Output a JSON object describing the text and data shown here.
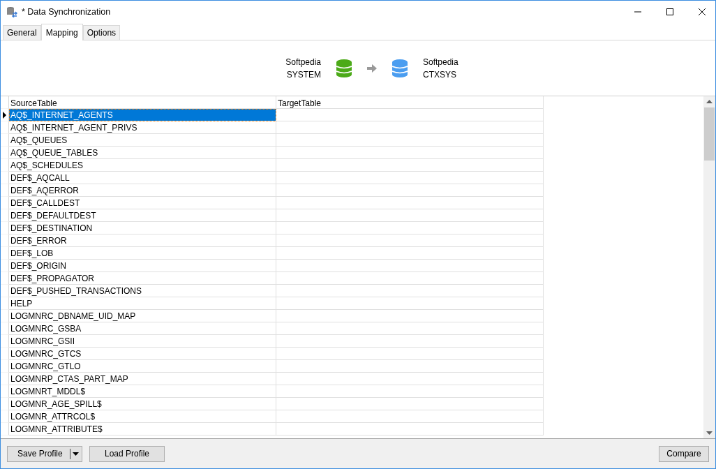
{
  "window": {
    "title": "* Data Synchronization"
  },
  "tabs": [
    {
      "label": "General",
      "selected": false
    },
    {
      "label": "Mapping",
      "selected": true
    },
    {
      "label": "Options",
      "selected": false
    }
  ],
  "source": {
    "name": "Softpedia",
    "schema": "SYSTEM"
  },
  "target": {
    "name": "Softpedia",
    "schema": "CTXSYS"
  },
  "table": {
    "columns": [
      "SourceTable",
      "TargetTable"
    ],
    "rows": [
      {
        "source": "AQ$_INTERNET_AGENTS",
        "selected": true
      },
      {
        "source": "AQ$_INTERNET_AGENT_PRIVS",
        "selected": false
      },
      {
        "source": "AQ$_QUEUES",
        "selected": false
      },
      {
        "source": "AQ$_QUEUE_TABLES",
        "selected": false
      },
      {
        "source": "AQ$_SCHEDULES",
        "selected": false
      },
      {
        "source": "DEF$_AQCALL",
        "selected": false
      },
      {
        "source": "DEF$_AQERROR",
        "selected": false
      },
      {
        "source": "DEF$_CALLDEST",
        "selected": false
      },
      {
        "source": "DEF$_DEFAULTDEST",
        "selected": false
      },
      {
        "source": "DEF$_DESTINATION",
        "selected": false
      },
      {
        "source": "DEF$_ERROR",
        "selected": false
      },
      {
        "source": "DEF$_LOB",
        "selected": false
      },
      {
        "source": "DEF$_ORIGIN",
        "selected": false
      },
      {
        "source": "DEF$_PROPAGATOR",
        "selected": false
      },
      {
        "source": "DEF$_PUSHED_TRANSACTIONS",
        "selected": false
      },
      {
        "source": "HELP",
        "selected": false
      },
      {
        "source": "LOGMNRC_DBNAME_UID_MAP",
        "selected": false
      },
      {
        "source": "LOGMNRC_GSBA",
        "selected": false
      },
      {
        "source": "LOGMNRC_GSII",
        "selected": false
      },
      {
        "source": "LOGMNRC_GTCS",
        "selected": false
      },
      {
        "source": "LOGMNRC_GTLO",
        "selected": false
      },
      {
        "source": "LOGMNRP_CTAS_PART_MAP",
        "selected": false
      },
      {
        "source": "LOGMNRT_MDDL$",
        "selected": false
      },
      {
        "source": "LOGMNR_AGE_SPILL$",
        "selected": false
      },
      {
        "source": "LOGMNR_ATTRCOL$",
        "selected": false
      },
      {
        "source": "LOGMNR_ATTRIBUTE$",
        "selected": false
      }
    ]
  },
  "buttons": {
    "save": "Save Profile",
    "load": "Load Profile",
    "compare": "Compare"
  }
}
